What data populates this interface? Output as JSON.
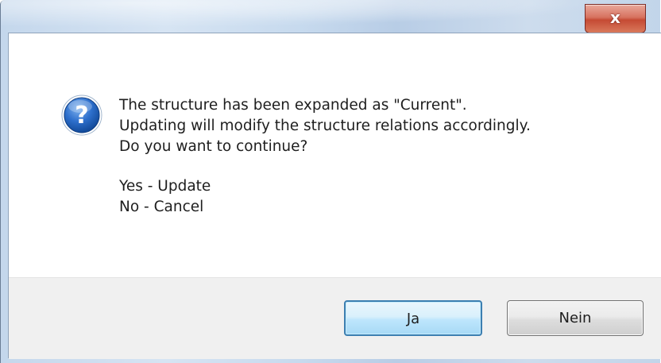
{
  "titlebar": {
    "close_icon": "close-x-icon",
    "close_glyph": "x"
  },
  "message": {
    "icon": "question-icon",
    "lines": [
      "The structure has been expanded as \"Current\".",
      "Updating will modify the structure relations accordingly.",
      "Do you want to continue?"
    ],
    "options": [
      "Yes - Update",
      "No - Cancel"
    ]
  },
  "buttons": {
    "yes_label": "Ja",
    "no_label": "Nein"
  },
  "colors": {
    "close_button": "#c54a34",
    "default_button_border": "#3c7fb1",
    "icon_blue": "#1c5fb4",
    "button_bar": "#f0f0f0"
  }
}
